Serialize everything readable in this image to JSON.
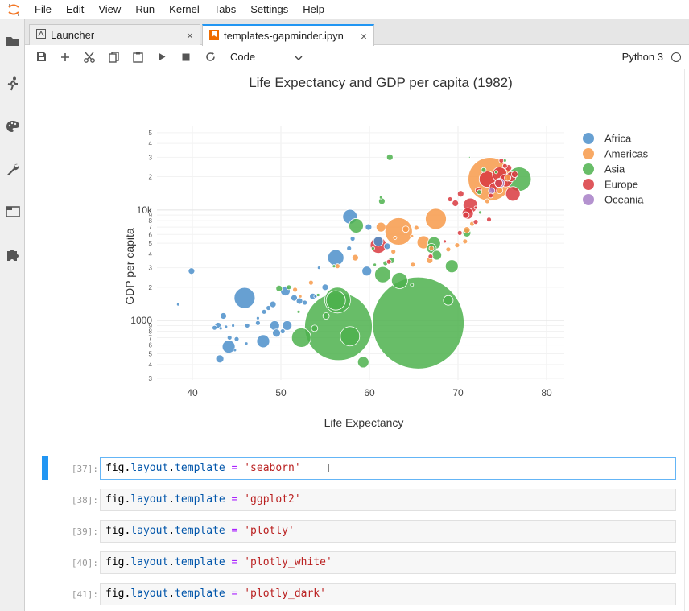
{
  "menubar": {
    "items": [
      "File",
      "Edit",
      "View",
      "Run",
      "Kernel",
      "Tabs",
      "Settings",
      "Help"
    ]
  },
  "tabs": [
    {
      "label": "Launcher",
      "close": "×"
    },
    {
      "label": "templates-gapminder.ipyn",
      "close": "×"
    }
  ],
  "toolbar": {
    "cell_type": "Code",
    "kernel_name": "Python 3"
  },
  "chart_data": {
    "type": "scatter",
    "title": "Life Expectancy and GDP per capita (1982)",
    "xlabel": "Life Expectancy",
    "ylabel": "GDP per capita",
    "x_scale": "linear",
    "y_scale": "log",
    "xlim": [
      36,
      82
    ],
    "ylim": [
      290,
      58000
    ],
    "x_ticks": [
      "40",
      "50",
      "60",
      "70",
      "80"
    ],
    "y_major_ticks": [
      "1000",
      "10k"
    ],
    "y_minor_ticks": [
      "3",
      "4",
      "5",
      "6",
      "7",
      "8",
      "9",
      "2"
    ],
    "grid": true,
    "legend_position": "top-right",
    "legend": [
      {
        "name": "Africa",
        "color": "#4c8fca"
      },
      {
        "name": "Americas",
        "color": "#f79a4a"
      },
      {
        "name": "Asia",
        "color": "#4db24d"
      },
      {
        "name": "Europe",
        "color": "#d93a3f"
      },
      {
        "name": "Oceania",
        "color": "#a77fc7"
      }
    ],
    "series": [
      {
        "name": "Africa",
        "points": [
          [
            45.9,
            1600,
            13
          ],
          [
            38.4,
            1400,
            2
          ],
          [
            39.9,
            2800,
            4
          ],
          [
            43.5,
            1100,
            4
          ],
          [
            42.9,
            900,
            4
          ],
          [
            43.2,
            850,
            2
          ],
          [
            44.6,
            900,
            2
          ],
          [
            46.2,
            900,
            3
          ],
          [
            47.4,
            1050,
            2
          ],
          [
            48.1,
            1200,
            3
          ],
          [
            49.1,
            1400,
            4
          ],
          [
            50.5,
            1850,
            6
          ],
          [
            51.5,
            1600,
            4
          ],
          [
            52.1,
            1500,
            4
          ],
          [
            53.6,
            1650,
            4
          ],
          [
            55.0,
            2000,
            4
          ],
          [
            54.3,
            3000,
            2
          ],
          [
            56.2,
            3700,
            10
          ],
          [
            57.7,
            4500,
            3
          ],
          [
            58.1,
            5500,
            3
          ],
          [
            59.9,
            7000,
            4
          ],
          [
            61.0,
            5200,
            6
          ],
          [
            62.0,
            4700,
            4
          ],
          [
            57.8,
            8700,
            9
          ],
          [
            59.7,
            2800,
            6
          ],
          [
            49.3,
            900,
            6
          ],
          [
            48.0,
            650,
            8
          ],
          [
            44.1,
            580,
            8
          ],
          [
            43.1,
            450,
            5
          ],
          [
            44.8,
            540,
            2
          ],
          [
            45.0,
            680,
            3
          ],
          [
            44.2,
            700,
            3
          ],
          [
            46.1,
            620,
            2
          ],
          [
            50.2,
            800,
            3
          ],
          [
            47.4,
            950,
            3
          ],
          [
            48.6,
            1300,
            3
          ],
          [
            52.7,
            1450,
            3
          ],
          [
            53.9,
            1650,
            2
          ],
          [
            50.7,
            900,
            6
          ],
          [
            42.5,
            860,
            3
          ],
          [
            38.5,
            860,
            1
          ],
          [
            43.8,
            880,
            2
          ],
          [
            49.5,
            770,
            5
          ]
        ]
      },
      {
        "name": "Americas",
        "points": [
          [
            73.6,
            19000,
            27
          ],
          [
            63.3,
            6400,
            17
          ],
          [
            67.5,
            8300,
            13
          ],
          [
            66.1,
            5100,
            8
          ],
          [
            61.3,
            7000,
            6
          ],
          [
            64.1,
            6700,
            4
          ],
          [
            62.7,
            4200,
            3
          ],
          [
            58.4,
            3700,
            4
          ],
          [
            56.4,
            3100,
            3
          ],
          [
            53.4,
            2200,
            3
          ],
          [
            51.6,
            1900,
            3
          ],
          [
            52.2,
            1650,
            2
          ],
          [
            64.9,
            3200,
            3
          ],
          [
            66.8,
            3500,
            4
          ],
          [
            68.9,
            4400,
            3
          ],
          [
            69.9,
            4800,
            3
          ],
          [
            71.0,
            6600,
            4
          ],
          [
            71.6,
            7500,
            3
          ],
          [
            73.3,
            12000,
            3
          ],
          [
            74.7,
            15000,
            4
          ],
          [
            75.6,
            19500,
            4
          ],
          [
            70.8,
            5200,
            3
          ],
          [
            67.0,
            4500,
            3
          ],
          [
            65.3,
            6900,
            3
          ],
          [
            62.9,
            5600,
            2
          ],
          [
            64.8,
            5800,
            2
          ]
        ]
      },
      {
        "name": "Asia",
        "points": [
          [
            65.5,
            950,
            57
          ],
          [
            56.5,
            880,
            42
          ],
          [
            56.4,
            1530,
            16
          ],
          [
            56.2,
            1520,
            12
          ],
          [
            76.9,
            19000,
            15
          ],
          [
            52.3,
            700,
            12
          ],
          [
            57.8,
            720,
            12
          ],
          [
            63.4,
            2300,
            10
          ],
          [
            61.5,
            2600,
            10
          ],
          [
            58.5,
            7200,
            9
          ],
          [
            69.3,
            3100,
            8
          ],
          [
            67.3,
            5000,
            8
          ],
          [
            67.0,
            4500,
            6
          ],
          [
            71.0,
            6200,
            5
          ],
          [
            62.3,
            30000,
            4
          ],
          [
            61.4,
            12000,
            4
          ],
          [
            62.5,
            3500,
            4
          ],
          [
            61.8,
            3300,
            3
          ],
          [
            59.3,
            420,
            7
          ],
          [
            53.8,
            850,
            4
          ],
          [
            49.8,
            1950,
            4
          ],
          [
            50.9,
            2000,
            3
          ],
          [
            54.2,
            1700,
            2
          ],
          [
            67.6,
            3900,
            6
          ],
          [
            68.9,
            1520,
            6
          ],
          [
            72.5,
            9500,
            2
          ],
          [
            72.4,
            14500,
            3
          ],
          [
            74.3,
            22000,
            2
          ],
          [
            75.3,
            28000,
            2
          ],
          [
            72.9,
            23000,
            3
          ],
          [
            61.3,
            13000,
            2
          ],
          [
            56.0,
            3100,
            2
          ],
          [
            55.1,
            1100,
            4
          ],
          [
            71.3,
            30000,
            1
          ],
          [
            60.4,
            4500,
            2
          ],
          [
            60.6,
            3200,
            2
          ],
          [
            52.0,
            1200,
            2
          ],
          [
            64.8,
            2100,
            2
          ]
        ]
      },
      {
        "name": "Europe",
        "points": [
          [
            73.3,
            19000,
            10
          ],
          [
            75.4,
            18500,
            8
          ],
          [
            74.7,
            21000,
            9
          ],
          [
            76.2,
            14000,
            9
          ],
          [
            71.4,
            11000,
            9
          ],
          [
            76.0,
            20000,
            6
          ],
          [
            74.1,
            16000,
            6
          ],
          [
            71.1,
            9300,
            7
          ],
          [
            69.1,
            12500,
            3
          ],
          [
            69.7,
            11500,
            4
          ],
          [
            70.3,
            14000,
            4
          ],
          [
            70.9,
            9000,
            4
          ],
          [
            72.3,
            15000,
            4
          ],
          [
            73.7,
            13500,
            3
          ],
          [
            74.6,
            17500,
            5
          ],
          [
            75.7,
            24000,
            4
          ],
          [
            75.3,
            25000,
            3
          ],
          [
            74.9,
            28000,
            3
          ],
          [
            61.0,
            4800,
            10
          ],
          [
            62.2,
            3400,
            3
          ],
          [
            66.9,
            3800,
            3
          ],
          [
            68.5,
            5200,
            2
          ],
          [
            70.2,
            6200,
            3
          ],
          [
            72.0,
            7800,
            3
          ],
          [
            73.5,
            8200,
            3
          ],
          [
            76.4,
            21000,
            4
          ],
          [
            72.0,
            10500,
            2
          ]
        ]
      },
      {
        "name": "Oceania",
        "points": [
          [
            74.7,
            17500,
            6
          ],
          [
            73.8,
            14900,
            4
          ]
        ]
      }
    ]
  },
  "cells": [
    {
      "prompt": "[37]:",
      "var": "fig",
      "dot1": ".",
      "attr1": "layout",
      "dot2": ".",
      "attr2": "template",
      "eq": " = ",
      "str": "'seaborn'",
      "active": true
    },
    {
      "prompt": "[38]:",
      "var": "fig",
      "dot1": ".",
      "attr1": "layout",
      "dot2": ".",
      "attr2": "template",
      "eq": " = ",
      "str": "'ggplot2'",
      "active": false
    },
    {
      "prompt": "[39]:",
      "var": "fig",
      "dot1": ".",
      "attr1": "layout",
      "dot2": ".",
      "attr2": "template",
      "eq": " = ",
      "str": "'plotly'",
      "active": false
    },
    {
      "prompt": "[40]:",
      "var": "fig",
      "dot1": ".",
      "attr1": "layout",
      "dot2": ".",
      "attr2": "template",
      "eq": " = ",
      "str": "'plotly_white'",
      "active": false
    },
    {
      "prompt": "[41]:",
      "var": "fig",
      "dot1": ".",
      "attr1": "layout",
      "dot2": ".",
      "attr2": "template",
      "eq": " = ",
      "str": "'plotly_dark'",
      "active": false
    }
  ]
}
